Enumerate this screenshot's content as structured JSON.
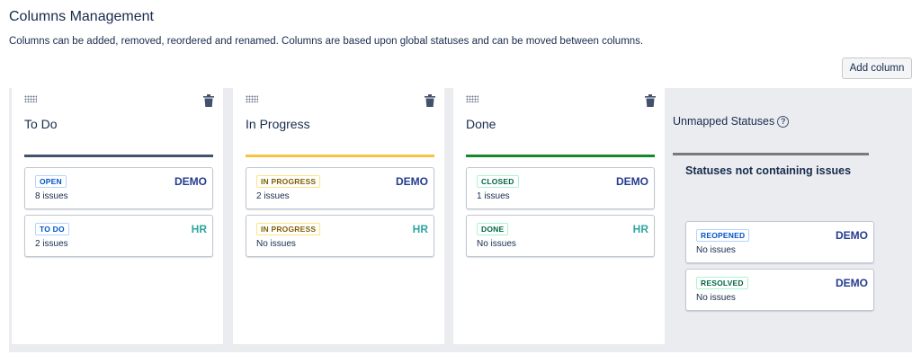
{
  "header": {
    "title": "Columns Management",
    "description": "Columns can be added, removed, reordered and renamed. Columns are based upon global statuses and can be moved between columns.",
    "add_column_label": "Add column"
  },
  "colors": {
    "todo": "#42526e",
    "in_progress": "#f6c342",
    "done": "#14892c",
    "unmapped": "#7a7a7a"
  },
  "columns": [
    {
      "title": "To Do",
      "icons": [
        "drag-handle-icon",
        "trash-icon"
      ],
      "cards": [
        {
          "status": "OPEN",
          "project": "DEMO",
          "count": "8 issues"
        },
        {
          "status": "TO DO",
          "project": "HR",
          "count": "2 issues"
        }
      ]
    },
    {
      "title": "In Progress",
      "icons": [
        "drag-handle-icon",
        "trash-icon"
      ],
      "cards": [
        {
          "status": "IN PROGRESS",
          "project": "DEMO",
          "count": "2 issues"
        },
        {
          "status": "IN PROGRESS",
          "project": "HR",
          "count": "No issues"
        }
      ]
    },
    {
      "title": "Done",
      "icons": [
        "drag-handle-icon",
        "trash-icon"
      ],
      "cards": [
        {
          "status": "CLOSED",
          "project": "DEMO",
          "count": "1 issues"
        },
        {
          "status": "DONE",
          "project": "HR",
          "count": "No issues"
        }
      ]
    }
  ],
  "unmapped": {
    "title": "Unmapped Statuses",
    "help_icon": "question-circle-icon",
    "subtitle": "Statuses not containing issues",
    "cards": [
      {
        "status": "REOPENED",
        "project": "DEMO",
        "count": "No issues"
      },
      {
        "status": "RESOLVED",
        "project": "DEMO",
        "count": "No issues"
      }
    ]
  }
}
